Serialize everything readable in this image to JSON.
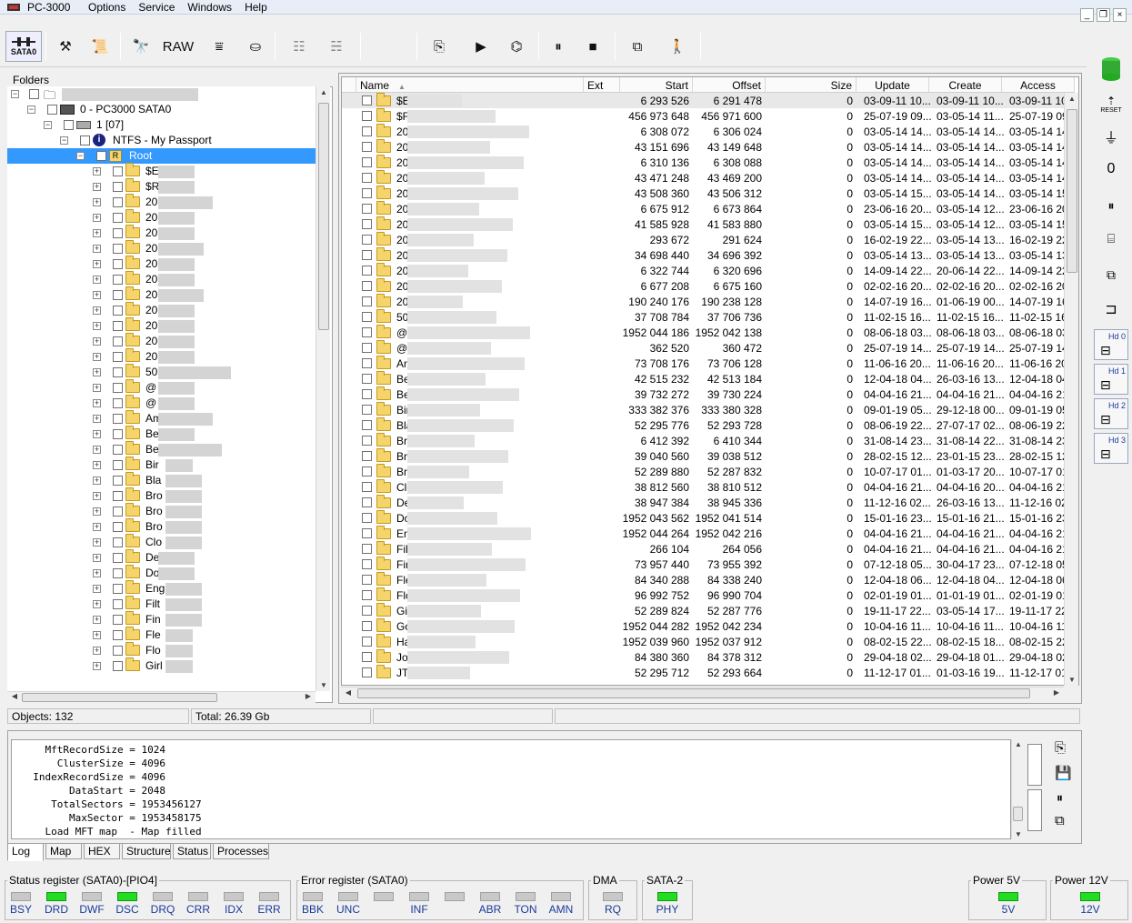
{
  "window": {
    "title": "PC-3000"
  },
  "menu": [
    "Options",
    "Service",
    "Windows",
    "Help"
  ],
  "toolbar": {
    "sata_label": "SATA0",
    "raw_label": "RAW"
  },
  "right_toolbar": {
    "reset_label": "RESET",
    "hd": [
      "Hd 0",
      "Hd 1",
      "Hd 2",
      "Hd 3"
    ]
  },
  "tree": {
    "header": "Folders",
    "nodes": [
      {
        "label": "0 - PC3000 SATA0"
      },
      {
        "label": "1 [07]"
      },
      {
        "label": "NTFS - My Passport"
      },
      {
        "label": "Root"
      }
    ],
    "children": [
      "$E",
      "$R",
      "20",
      "20",
      "20",
      "20",
      "20",
      "20",
      "20",
      "20",
      "20",
      "20",
      "20",
      "50",
      "@",
      "@",
      "Am",
      "Be",
      "Be",
      "Bir",
      "Bla",
      "Bro",
      "Bro",
      "Bro",
      "Clo",
      "De",
      "Do",
      "Eng",
      "Filt",
      "Fin",
      "Fle",
      "Flo",
      "Girl"
    ]
  },
  "list": {
    "columns": [
      "Name",
      "Ext",
      "Start",
      "Offset",
      "Size",
      "Update",
      "Create",
      "Access"
    ],
    "rows": [
      [
        "$E",
        "6 293 526",
        "6 291 478",
        "0",
        "03-09-11 10...",
        "03-09-11 10...",
        "03-09-11 10"
      ],
      [
        "$F",
        "456 973 648",
        "456 971 600",
        "0",
        "25-07-19 09...",
        "03-05-14 11...",
        "25-07-19 09"
      ],
      [
        "20",
        "6 308 072",
        "6 306 024",
        "0",
        "03-05-14 14...",
        "03-05-14 14...",
        "03-05-14 14"
      ],
      [
        "20",
        "43 151 696",
        "43 149 648",
        "0",
        "03-05-14 14...",
        "03-05-14 14...",
        "03-05-14 14"
      ],
      [
        "20",
        "6 310 136",
        "6 308 088",
        "0",
        "03-05-14 14...",
        "03-05-14 14...",
        "03-05-14 14"
      ],
      [
        "20",
        "43 471 248",
        "43 469 200",
        "0",
        "03-05-14 14...",
        "03-05-14 14...",
        "03-05-14 14"
      ],
      [
        "20",
        "43 508 360",
        "43 506 312",
        "0",
        "03-05-14 15...",
        "03-05-14 14...",
        "03-05-14 15"
      ],
      [
        "20",
        "6 675 912",
        "6 673 864",
        "0",
        "23-06-16 20...",
        "03-05-14 12...",
        "23-06-16 20"
      ],
      [
        "20",
        "41 585 928",
        "41 583 880",
        "0",
        "03-05-14 15...",
        "03-05-14 12...",
        "03-05-14 15"
      ],
      [
        "20",
        "293 672",
        "291 624",
        "0",
        "16-02-19 22...",
        "03-05-14 13...",
        "16-02-19 22"
      ],
      [
        "20",
        "34 698 440",
        "34 696 392",
        "0",
        "03-05-14 13...",
        "03-05-14 13...",
        "03-05-14 13"
      ],
      [
        "20",
        "6 322 744",
        "6 320 696",
        "0",
        "14-09-14 22...",
        "20-06-14 22...",
        "14-09-14 22"
      ],
      [
        "20",
        "6 677 208",
        "6 675 160",
        "0",
        "02-02-16 20...",
        "02-02-16 20...",
        "02-02-16 20"
      ],
      [
        "20",
        "190 240 176",
        "190 238 128",
        "0",
        "14-07-19 16...",
        "01-06-19 00...",
        "14-07-19 16"
      ],
      [
        "50",
        "37 708 784",
        "37 706 736",
        "0",
        "11-02-15 16...",
        "11-02-15 16...",
        "11-02-15 16"
      ],
      [
        "@",
        "1952 044 186",
        "1952 042 138",
        "0",
        "08-06-18 03...",
        "08-06-18 03...",
        "08-06-18 03"
      ],
      [
        "@",
        "362 520",
        "360 472",
        "0",
        "25-07-19 14...",
        "25-07-19 14...",
        "25-07-19 14"
      ],
      [
        "An",
        "73 708 176",
        "73 706 128",
        "0",
        "11-06-16 20...",
        "11-06-16 20...",
        "11-06-16 20"
      ],
      [
        "Be",
        "42 515 232",
        "42 513 184",
        "0",
        "12-04-18 04...",
        "26-03-16 13...",
        "12-04-18 04"
      ],
      [
        "Be",
        "39 732 272",
        "39 730 224",
        "0",
        "04-04-16 21...",
        "04-04-16 21...",
        "04-04-16 21"
      ],
      [
        "Bir",
        "333 382 376",
        "333 380 328",
        "0",
        "09-01-19 05...",
        "29-12-18 00...",
        "09-01-19 05"
      ],
      [
        "Bla",
        "52 295 776",
        "52 293 728",
        "0",
        "08-06-19 22...",
        "27-07-17 02...",
        "08-06-19 22"
      ],
      [
        "Br",
        "6 412 392",
        "6 410 344",
        "0",
        "31-08-14 23...",
        "31-08-14 22...",
        "31-08-14 23"
      ],
      [
        "Br",
        "39 040 560",
        "39 038 512",
        "0",
        "28-02-15 12...",
        "23-01-15 23...",
        "28-02-15 12"
      ],
      [
        "Br",
        "52 289 880",
        "52 287 832",
        "0",
        "10-07-17 01...",
        "01-03-17 20...",
        "10-07-17 01"
      ],
      [
        "Clo",
        "38 812 560",
        "38 810 512",
        "0",
        "04-04-16 21...",
        "04-04-16 20...",
        "04-04-16 21"
      ],
      [
        "De",
        "38 947 384",
        "38 945 336",
        "0",
        "11-12-16 02...",
        "26-03-16 13...",
        "11-12-16 02"
      ],
      [
        "Do",
        "1952 043 562",
        "1952 041 514",
        "0",
        "15-01-16 23...",
        "15-01-16 21...",
        "15-01-16 23"
      ],
      [
        "En",
        "1952 044 264",
        "1952 042 216",
        "0",
        "04-04-16 21...",
        "04-04-16 21...",
        "04-04-16 21"
      ],
      [
        "Fil",
        "266 104",
        "264 056",
        "0",
        "04-04-16 21...",
        "04-04-16 21...",
        "04-04-16 21"
      ],
      [
        "Fir",
        "73 957 440",
        "73 955 392",
        "0",
        "07-12-18 05...",
        "30-04-17 23...",
        "07-12-18 05"
      ],
      [
        "Fle",
        "84 340 288",
        "84 338 240",
        "0",
        "12-04-18 06...",
        "12-04-18 04...",
        "12-04-18 06"
      ],
      [
        "Flo",
        "96 992 752",
        "96 990 704",
        "0",
        "02-01-19 01...",
        "01-01-19 01...",
        "02-01-19 01"
      ],
      [
        "Gi",
        "52 289 824",
        "52 287 776",
        "0",
        "19-11-17 22...",
        "03-05-14 17...",
        "19-11-17 22"
      ],
      [
        "Go",
        "1952 044 282",
        "1952 042 234",
        "0",
        "10-04-16 11...",
        "10-04-16 11...",
        "10-04-16 11"
      ],
      [
        "Ha",
        "1952 039 960",
        "1952 037 912",
        "0",
        "08-02-15 22...",
        "08-02-15 18...",
        "08-02-15 22"
      ],
      [
        "Jo",
        "84 380 360",
        "84 378 312",
        "0",
        "29-04-18 02...",
        "29-04-18 01...",
        "29-04-18 02"
      ],
      [
        "JT",
        "52 295 712",
        "52 293 664",
        "0",
        "11-12-17 01...",
        "01-03-16 19...",
        "11-12-17 01"
      ]
    ]
  },
  "statusbar": {
    "objects": "Objects: 132",
    "total": "Total: 26.39 Gb"
  },
  "log": {
    "lines": [
      "    MftRecordSize = 1024",
      "      ClusterSize = 4096",
      "  IndexRecordSize = 4096",
      "        DataStart = 2048",
      "     TotalSectors = 1953456127",
      "        MaxSector = 1953458175",
      "    Load MFT map  - Map filled"
    ],
    "tabs": [
      "Log",
      "Map",
      "HEX",
      "Structure",
      "Status",
      "Processes"
    ]
  },
  "registers": {
    "status": {
      "title": "Status register (SATA0)-[PIO4]",
      "leds": [
        {
          "label": "BSY",
          "on": false
        },
        {
          "label": "DRD",
          "on": true
        },
        {
          "label": "DWF",
          "on": false
        },
        {
          "label": "DSC",
          "on": true
        },
        {
          "label": "DRQ",
          "on": false
        },
        {
          "label": "CRR",
          "on": false
        },
        {
          "label": "IDX",
          "on": false
        },
        {
          "label": "ERR",
          "on": false
        }
      ]
    },
    "error": {
      "title": "Error register (SATA0)",
      "leds": [
        {
          "label": "BBK",
          "on": false
        },
        {
          "label": "UNC",
          "on": false
        },
        {
          "label": "",
          "on": false
        },
        {
          "label": "INF",
          "on": false
        },
        {
          "label": "",
          "on": false
        },
        {
          "label": "ABR",
          "on": false
        },
        {
          "label": "TON",
          "on": false
        },
        {
          "label": "AMN",
          "on": false
        }
      ]
    },
    "dma": {
      "title": "DMA",
      "leds": [
        {
          "label": "RQ",
          "on": false
        }
      ]
    },
    "sata2": {
      "title": "SATA-2",
      "leds": [
        {
          "label": "PHY",
          "on": true
        }
      ]
    },
    "power5": {
      "title": "Power 5V",
      "leds": [
        {
          "label": "5V",
          "on": true
        }
      ]
    },
    "power12": {
      "title": "Power 12V",
      "leds": [
        {
          "label": "12V",
          "on": true
        }
      ]
    }
  }
}
